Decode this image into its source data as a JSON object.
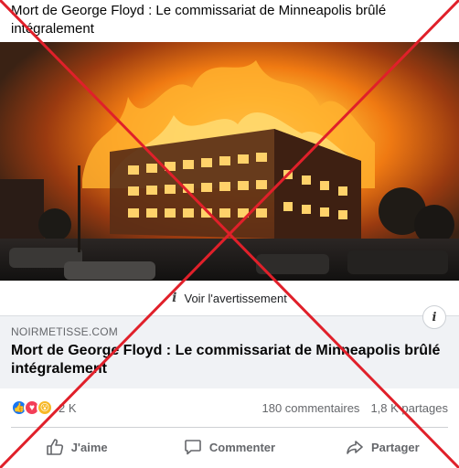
{
  "post": {
    "text": "Mort de George Floyd : Le commissariat de Minneapolis brûlé intégralement"
  },
  "warning": {
    "icon": "info-icon",
    "label": "Voir l'avertissement"
  },
  "link_preview": {
    "domain": "NOIRMETISSE.COM",
    "title": "Mort de George Floyd : Le commissariat de Minneapolis brûlé intégralement",
    "info_icon": "info-icon"
  },
  "stats": {
    "reactions": [
      "like",
      "love",
      "wow"
    ],
    "reaction_count": "2 K",
    "comments": "180 commentaires",
    "shares": "1,8 K partages"
  },
  "actions": {
    "like_label": "J'aime",
    "comment_label": "Commenter",
    "share_label": "Partager"
  },
  "overlay": {
    "cross_color": "#e0202a"
  }
}
